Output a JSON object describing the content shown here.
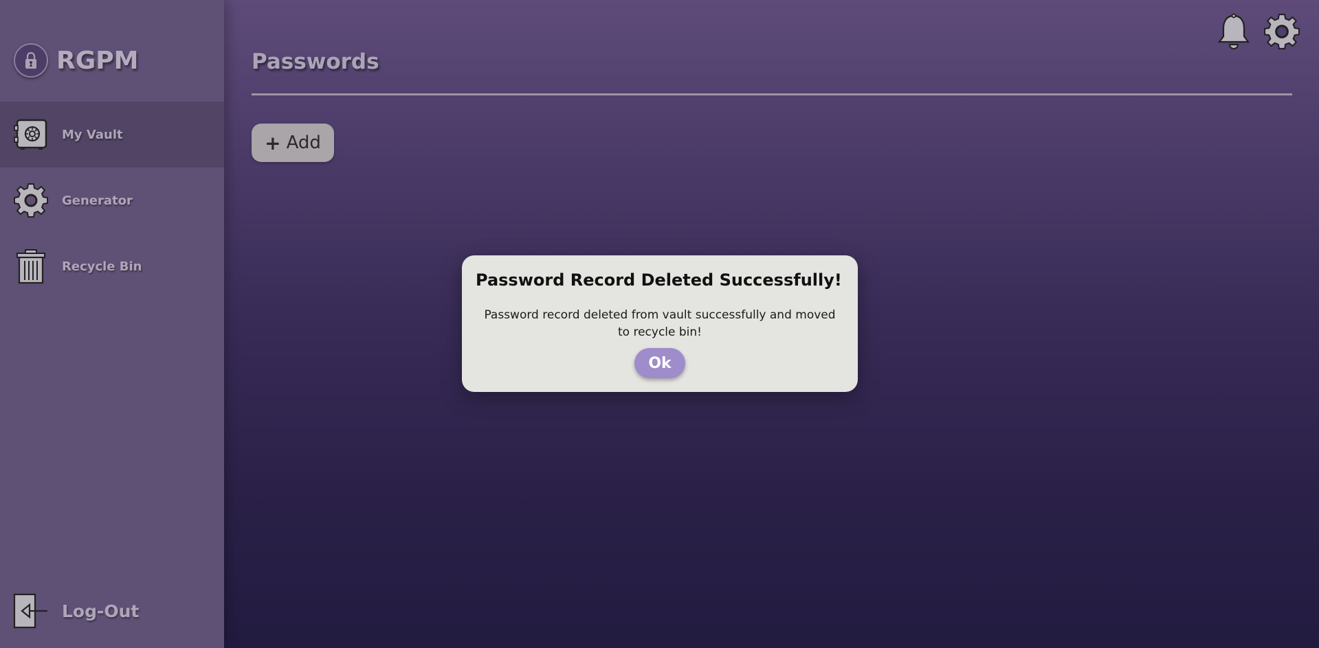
{
  "app": {
    "brand_name": "RGPM",
    "logo_icon": "lock-logo-icon"
  },
  "sidebar": {
    "items": [
      {
        "label": "My Vault",
        "icon": "safe-icon",
        "active": true
      },
      {
        "label": "Generator",
        "icon": "gear-icon",
        "active": false
      },
      {
        "label": "Recycle Bin",
        "icon": "trash-icon",
        "active": false
      }
    ],
    "logout_label": "Log-Out"
  },
  "header": {
    "title": "Passwords",
    "icons": [
      "bell-icon",
      "settings-icon"
    ]
  },
  "main": {
    "add_label": "Add",
    "add_icon": "+"
  },
  "modal": {
    "title": "Password Record Deleted Successfully!",
    "message": "Password record deleted from vault successfully and moved to recycle bin!",
    "ok_label": "Ok"
  },
  "colors": {
    "sidebar_bg": "#5f5075",
    "sidebar_active": "#514465",
    "ok_button": "#9f8ccb",
    "modal_bg": "#e4e4e0",
    "add_button": "#a9a5a9"
  }
}
